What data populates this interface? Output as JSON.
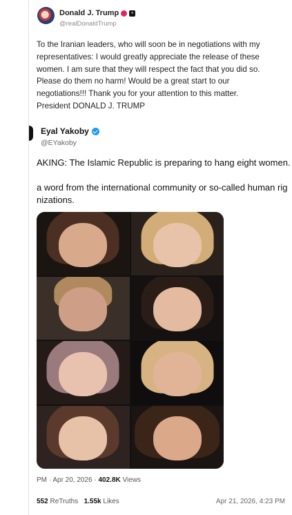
{
  "post": {
    "author_name": "Donald J. Trump",
    "author_handle": "@realDonaldTrump",
    "body": "To the Iranian leaders, who will soon be in negotiations with my\nrepresentatives: I would greatly appreciate the release of these\nwomen. I am sure that they will respect the fact that you did so.\nPlease do them no harm! Would be a great start to our\nnegotiations!!! Thank you for your attention to this matter.\nPresident DONALD J. TRUMP",
    "retruths_count": "552",
    "retruths_label": "ReTruths",
    "likes_count": "1.55k",
    "likes_label": "Likes",
    "date": "Apr 21, 2026, 4:23 PM"
  },
  "quoted": {
    "author_name": "Eyal Yakoby",
    "author_handle": "@EYakoby",
    "line1": "AKING: The Islamic Republic is preparing to hang eight women.",
    "line2": "a word from the international community or so-called human rig",
    "line3": "nizations.",
    "meta_time": "PM · Apr 20, 2026 · ",
    "meta_views_count": "402.8K",
    "meta_views_label": " Views"
  },
  "colors": {
    "verified_blue": "#1d9bf0",
    "truth_badge_red": "#e0245e"
  }
}
